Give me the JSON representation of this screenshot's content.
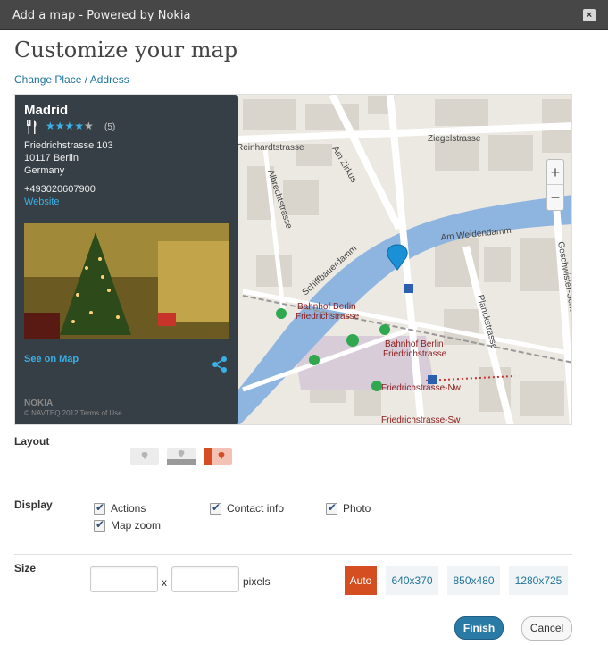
{
  "window": {
    "title": "Add a map - Powered by Nokia",
    "close_label": "×"
  },
  "heading": "Customize your map",
  "change_place_link": "Change Place / Address",
  "place_card": {
    "name": "Madrid",
    "rating": 4,
    "rating_max": 5,
    "stars": "★★★★",
    "stars_empty": "★",
    "review_count": "(5)",
    "address_lines": [
      "Friedrichstrasse 103",
      "10117 Berlin",
      "Germany"
    ],
    "phone": "+493020607900",
    "website_label": "Website",
    "see_on_map_label": "See on Map",
    "provider_logo_text": "NOKIA",
    "terms_text": "© NAVTEQ 2012  Terms of Use"
  },
  "map_labels": {
    "streets": [
      "Reinhardtstrasse",
      "Albrechtstrasse",
      "Am Zirkus",
      "Ziegelstrasse",
      "Am Weidendamm",
      "Schiffbauerdamm",
      "Planckstrasse",
      "Geschwister-Scholl-Strasse",
      "Reinhardtstr."
    ],
    "stations": [
      "Bahnhof Berlin Friedrichstrasse",
      "Bahnhof Berlin Friedrichstrasse",
      "Friedrichstrasse-Nw",
      "Friedrichstrasse-Sw"
    ]
  },
  "map_zoom": {
    "plus": "+",
    "minus": "−"
  },
  "layout": {
    "label": "Layout",
    "options": [
      "layout-1",
      "layout-2",
      "layout-3"
    ],
    "selected": 2
  },
  "display": {
    "label": "Display",
    "options": [
      {
        "label": "Actions",
        "checked": true
      },
      {
        "label": "Contact info",
        "checked": true
      },
      {
        "label": "Photo",
        "checked": true
      },
      {
        "label": "Map zoom",
        "checked": true
      }
    ]
  },
  "size": {
    "label": "Size",
    "width_value": "",
    "height_value": "",
    "separator": "x",
    "unit": "pixels",
    "presets": [
      "Auto",
      "640x370",
      "850x480",
      "1280x725"
    ],
    "selected": "Auto"
  },
  "buttons": {
    "finish": "Finish",
    "cancel": "Cancel"
  },
  "colors": {
    "accent": "#d54e21",
    "primary": "#2a7aa6",
    "link": "#21759b",
    "water": "#8eb4e0"
  }
}
